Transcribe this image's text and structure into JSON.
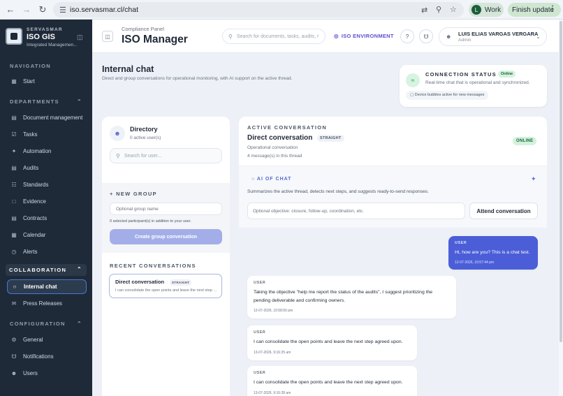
{
  "browser": {
    "url": "iso.servasmar.cl/chat",
    "profile_initial": "L",
    "profile_label": "Work",
    "finish_label": "Finish update"
  },
  "sidebar": {
    "brand_top": "SERVASMAR",
    "brand_name": "ISO GIS",
    "brand_sub": "Integrated Managemen...",
    "sections": {
      "navigation": "NAVIGATION",
      "departments": "DEPARTMENTS",
      "collaboration": "COLLABORATION",
      "configuration": "CONFIGURATION"
    },
    "items": [
      {
        "label": "Start",
        "icon": "grid-icon"
      },
      {
        "label": "Document management",
        "icon": "document-icon"
      },
      {
        "label": "Tasks",
        "icon": "checkbox-icon"
      },
      {
        "label": "Automation",
        "icon": "spark-icon"
      },
      {
        "label": "Audits",
        "icon": "clipboard-icon"
      },
      {
        "label": "Standards",
        "icon": "book-icon"
      },
      {
        "label": "Evidence",
        "icon": "file-icon"
      },
      {
        "label": "Contracts",
        "icon": "contract-icon"
      },
      {
        "label": "Calendar",
        "icon": "calendar-icon"
      },
      {
        "label": "Alerts",
        "icon": "alert-icon"
      },
      {
        "label": "Internal chat",
        "icon": "chat-icon"
      },
      {
        "label": "Press Releases",
        "icon": "mail-icon"
      },
      {
        "label": "General",
        "icon": "gear-icon"
      },
      {
        "label": "Notifications",
        "icon": "bell-icon"
      },
      {
        "label": "Users",
        "icon": "users-icon"
      }
    ]
  },
  "header": {
    "subtitle": "Compliance Panel",
    "title": "ISO Manager",
    "search_placeholder": "Search for documents, tasks, audits, r",
    "environment": "ISO ENVIRONMENT",
    "user_name": "LUIS ELIAS VARGAS VERGARA",
    "user_role": "Admin"
  },
  "page": {
    "title": "Internal chat",
    "description": "Direct and group conversations for operational monitoring, with AI support on the active thread."
  },
  "connection": {
    "title": "CONNECTION STATUS",
    "badge": "Online",
    "description": "Real-time chat that is operational and synchronized.",
    "pill": "Device bubbles active for new messages"
  },
  "directory": {
    "title": "Directory",
    "count": "0 active user(s)",
    "search_placeholder": "Search for user...",
    "new_group_title": "+ NEW GROUP",
    "group_name_placeholder": "Optional group name",
    "selected_note": "0 selected participant(s) in addition to your user.",
    "create_button": "Create group conversation",
    "recent_title": "RECENT CONVERSATIONS",
    "recent": [
      {
        "title": "Direct conversation",
        "badge": "STRAIGHT",
        "preview": "I can consolidate the open points and leave the next step agreed upon."
      }
    ]
  },
  "conversation": {
    "label": "ACTIVE CONVERSATION",
    "title": "Direct conversation",
    "badge": "STRAIGHT",
    "status": "ONLINE",
    "meta": "Operational conversation",
    "count": "4 message(s) in this thread",
    "ai_title": "AI OF CHAT",
    "ai_desc": "Summarizes the active thread, detects next steps, and suggests ready-to-send responses.",
    "objective_placeholder": "Optional objective: closure, follow-up, coordination, etc.",
    "attend_button": "Attend conversation",
    "messages": [
      {
        "sender": "USER",
        "text": "Hi, how are you? This is a chat test.",
        "time": "12-07-2026, 10:57:44 pm",
        "mine": true
      },
      {
        "sender": "USER",
        "text1": "Taking the objective \"help me report the status of the audits\", I suggest prioritizing the",
        "text2": "pending deliverable and confirming owners.",
        "time": "12-07-2026, 10:58:50 pm",
        "mine": false
      },
      {
        "sender": "USER",
        "text": "I can consolidate the open points and leave the next step agreed upon.",
        "time": "13-07-2026, 9:16:25 am",
        "mine": false
      },
      {
        "sender": "USER",
        "text": "I can consolidate the open points and leave the next step agreed upon.",
        "time": "13-07-2026, 9:16:28 am",
        "mine": false
      }
    ]
  }
}
